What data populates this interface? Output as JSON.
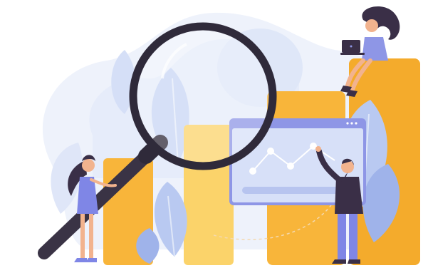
{
  "illustration": {
    "palette": {
      "background": "#ffffff",
      "blob_light": "#eef2fb",
      "blob_mid": "#dfe7f8",
      "bar_orange": "#f8b53a",
      "bar_orange_dark": "#f0a322",
      "bar_light": "#fbd36a",
      "leaf_blue": "#b9c9f1",
      "leaf_blue_dark": "#9fb3ea",
      "screen_frame": "#8e96e6",
      "screen_bg": "#d7e0f8",
      "screen_line": "#ffffff",
      "lens_ring": "#2f2a3a",
      "lens_handle": "#3a3345",
      "figure_dark": "#3a2f47",
      "figure_purple": "#7f86e6",
      "figure_skin": "#f2b38e"
    },
    "elements": [
      "background-blob",
      "bar-chart-columns",
      "chart-screen",
      "magnifying-glass",
      "woman-with-laptop",
      "woman-with-glass",
      "man-pointing",
      "decorative-leaves"
    ]
  }
}
